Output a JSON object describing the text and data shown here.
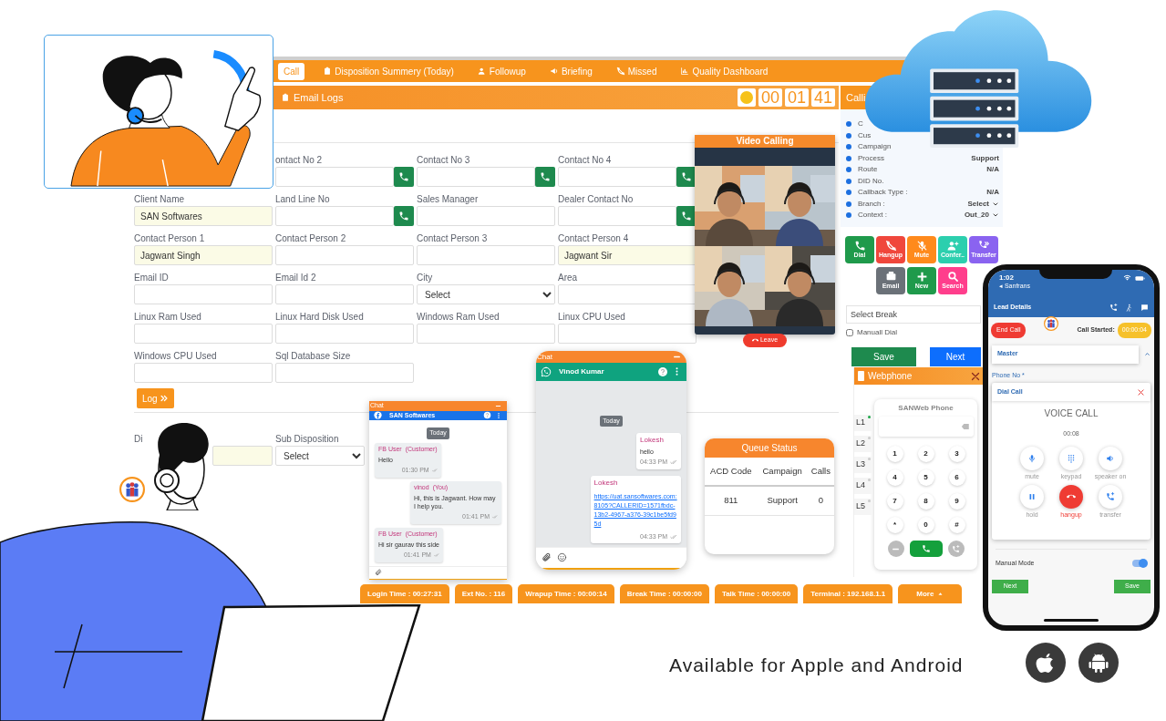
{
  "nav_tabs": [
    {
      "label": "Call",
      "selected": true
    },
    {
      "label": "Disposition Summery (Today)",
      "selected": false
    },
    {
      "label": "Followup",
      "selected": false
    },
    {
      "label": "Briefing",
      "selected": false
    },
    {
      "label": "Missed",
      "selected": false
    },
    {
      "label": "Quality Dashboard",
      "selected": false
    }
  ],
  "sub_header": {
    "label": "Email Logs",
    "timer": [
      "00",
      "01",
      "41"
    ]
  },
  "form_rows": [
    [
      {
        "label": "ontact No 2",
        "kind": "phone",
        "highlighted": false
      },
      {
        "label": "Contact No 3",
        "kind": "phone",
        "highlighted": false
      },
      {
        "label": "Contact No 4",
        "kind": "phone",
        "highlighted": false
      }
    ],
    [
      {
        "label": "Client Name",
        "kind": "text",
        "value": "SAN Softwares",
        "highlighted": true
      },
      {
        "label": "Land Line No",
        "kind": "phone",
        "highlighted": false
      },
      {
        "label": "Sales Manager",
        "kind": "text",
        "highlighted": false
      },
      {
        "label": "Dealer Contact No",
        "kind": "phone",
        "highlighted": false
      }
    ],
    [
      {
        "label": "Contact Person 1",
        "kind": "text",
        "value": "Jagwant Singh",
        "highlighted": true
      },
      {
        "label": "Contact Person 2",
        "kind": "text",
        "highlighted": false
      },
      {
        "label": "Contact Person 3",
        "kind": "text",
        "highlighted": false
      },
      {
        "label": "Contact Person 4",
        "kind": "text",
        "value": "Jagwant Sir",
        "highlighted": true
      }
    ],
    [
      {
        "label": "Email ID",
        "kind": "text",
        "highlighted": false
      },
      {
        "label": "Email Id 2",
        "kind": "text",
        "highlighted": false
      },
      {
        "label": "City",
        "kind": "select",
        "value": "Select"
      },
      {
        "label": "Area",
        "kind": "text",
        "highlighted": false
      }
    ],
    [
      {
        "label": "Linux Ram Used",
        "kind": "text",
        "highlighted": false
      },
      {
        "label": "Linux Hard Disk Used",
        "kind": "text",
        "highlighted": false
      },
      {
        "label": "Windows Ram Used",
        "kind": "text",
        "highlighted": false
      },
      {
        "label": "Linux CPU Used",
        "kind": "text",
        "highlighted": false
      }
    ],
    [
      {
        "label": "Windows CPU Used",
        "kind": "text",
        "highlighted": false
      },
      {
        "label": "Sql Database Size",
        "kind": "text",
        "highlighted": false
      }
    ]
  ],
  "log_button": "Log",
  "disposition_row": [
    {
      "label": "Di",
      "kind": "text",
      "highlighted": true
    },
    {
      "label": "Sub Disposition",
      "kind": "select",
      "value": "Select"
    }
  ],
  "call_panel": {
    "title": "Calli",
    "items": [
      {
        "label": "C"
      },
      {
        "label": "Cus"
      },
      {
        "label": "Campaign"
      },
      {
        "label": "Process",
        "value": "Support",
        "kind": "text"
      },
      {
        "label": "Route",
        "value": "N/A",
        "kind": "text"
      },
      {
        "label": "DID No."
      },
      {
        "label": "Callback Type :",
        "value": "N/A",
        "kind": "text"
      },
      {
        "label": "Branch :",
        "value": "Select",
        "kind": "select"
      },
      {
        "label": "Context :",
        "value": "Out_20",
        "kind": "select"
      }
    ],
    "actions": [
      {
        "label": "Dial",
        "color": "#1f9a4b"
      },
      {
        "label": "Hangup",
        "color": "#f0473c"
      },
      {
        "label": "Mute",
        "color": "#ff8a1c"
      },
      {
        "label": "Confer..",
        "color": "#2ccfae"
      },
      {
        "label": "Transfer",
        "color": "#8a63f0"
      },
      {
        "label": "Email",
        "color": "#6b7178"
      },
      {
        "label": "New",
        "color": "#1f9a4b"
      },
      {
        "label": "Search",
        "color": "#ff3e8c"
      }
    ],
    "break_select": "Select Break",
    "manual_dial": {
      "label": "Manuall Dial",
      "checked": false
    },
    "buttons": [
      {
        "label": "Save",
        "kind": "save"
      },
      {
        "label": "Next",
        "kind": "next"
      }
    ]
  },
  "video_call": {
    "title": "Video Calling",
    "leave": "Leave"
  },
  "fb_chat": {
    "kind": "facebook",
    "window_title": "Chat",
    "contact": "SAN Softwares",
    "day": "Today",
    "messages": [
      {
        "sender": "FB User",
        "role": "(Customer)",
        "text": "Hello",
        "time": "01:30 PM",
        "outgoing": false
      },
      {
        "sender": "vinod",
        "role": "(You)",
        "text": "Hi, this is Jagwant. How may I help you.",
        "time": "01:41 PM",
        "outgoing": true
      },
      {
        "sender": "FB User",
        "role": "(Customer)",
        "text": "Hi sir gaurav this side",
        "time": "01:41 PM",
        "outgoing": false
      }
    ]
  },
  "wa_chat": {
    "kind": "whatsapp",
    "window_title": "Chat",
    "contact": "Vinod Kumar",
    "day": "Today",
    "messages": [
      {
        "sender": "Lokesh",
        "text": "hello",
        "time": "04:33 PM",
        "outgoing": true
      },
      {
        "sender": "Lokesh",
        "link": "https://uat.sansoftwares.com:8105?CALLERID=1571fbdc-13b2-4967-a376-39c1be5fd95d",
        "time": "04:33 PM",
        "outgoing": true
      }
    ]
  },
  "queue_status": {
    "title": "Queue Status",
    "columns": [
      "ACD Code",
      "Campaign",
      "Calls"
    ],
    "rows": [
      [
        "811",
        "Support",
        "0"
      ]
    ]
  },
  "webphone": {
    "title": "Webphone",
    "lines": [
      {
        "label": "L1",
        "active": true
      },
      {
        "label": "L2",
        "active": false
      },
      {
        "label": "L3",
        "active": false
      },
      {
        "label": "L4",
        "active": false
      },
      {
        "label": "L5",
        "active": false
      }
    ],
    "dialer_title": "SANWeb Phone",
    "keys": [
      "1",
      "2",
      "3",
      "4",
      "5",
      "6",
      "7",
      "8",
      "9",
      "*",
      "0",
      "#"
    ]
  },
  "status_bar": [
    "Login Time : 00:27:31",
    "Ext No. : 116",
    "Wrapup Time : 00:00:14",
    "Break Time : 00:00:00",
    "Talk Time : 00:00:00",
    "Terminal : 192.168.1.1"
  ],
  "more_button": "More",
  "mobile": {
    "status_time": "1:02",
    "back_label": "◂ Sanfrans",
    "title": "Lead Details",
    "end_call": "End Call",
    "call_started_label": "Call Started:",
    "call_started": "00:00:04",
    "section": "Master",
    "phone_label": "Phone No *",
    "dial_call": "Dial Call",
    "voice_call": "VOICE CALL",
    "duration": "00:08",
    "controls": [
      {
        "label": "mute",
        "kind": "normal"
      },
      {
        "label": "keypad",
        "kind": "normal"
      },
      {
        "label": "speaker on",
        "kind": "normal"
      },
      {
        "label": "hold",
        "kind": "normal"
      },
      {
        "label": "hangup",
        "kind": "danger"
      },
      {
        "label": "transfer",
        "kind": "normal"
      }
    ],
    "manual_mode": {
      "label": "Manual Mode",
      "on": true
    },
    "buttons": [
      "Next",
      "Save"
    ]
  },
  "availability": "Available for Apple and Android"
}
